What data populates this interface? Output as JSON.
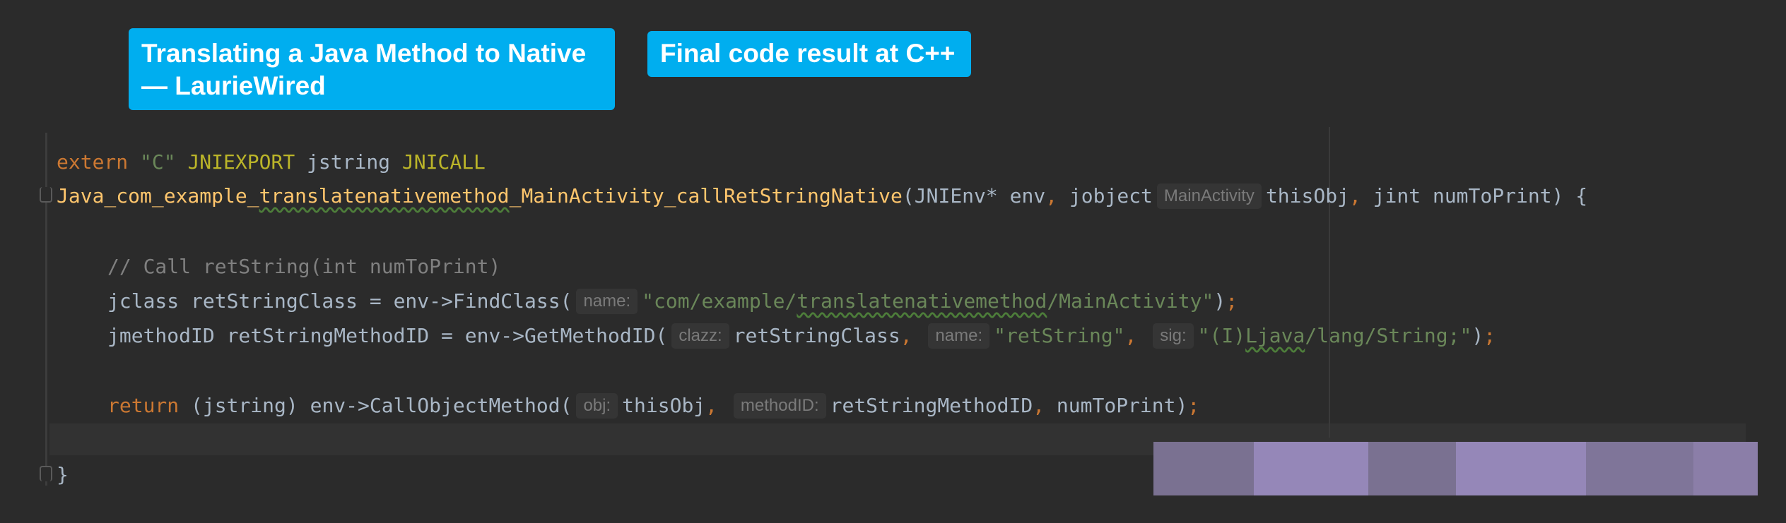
{
  "labels": {
    "title_line1": "Translating a Java Method to Native",
    "title_line2": "— LaurieWired",
    "result": "Final code result at C++"
  },
  "code": {
    "line1": {
      "kw1": "extern",
      "str1": "\"C\"",
      "macro1": "JNIEXPORT",
      "type1": "jstring",
      "macro2": "JNICALL"
    },
    "line2": {
      "fn_part1": "Java_com_example_",
      "fn_part2": "translatenativemethod",
      "fn_part3": "_MainActivity_callRetStringNative",
      "args1": "(JNIEnv* env",
      "comma1": ",",
      "args2": " jobject",
      "hint": "MainActivity",
      "args3": "thisObj",
      "comma2": ",",
      "args4": " jint numToPrint) {"
    },
    "line3": {
      "comment": "// Call retString(int numToPrint)"
    },
    "line4": {
      "pre": "jclass retStringClass = env->FindClass(",
      "hint": "name:",
      "str_part1": "\"com/example/",
      "str_part2": "translatenativemethod",
      "str_part3": "/MainActivity\"",
      "post": ")",
      "semi": ";"
    },
    "line5": {
      "pre": "jmethodID retStringMethodID = env->GetMethodID(",
      "hint1": "clazz:",
      "arg1": "retStringClass",
      "comma1": ",",
      "hint2": "name:",
      "str1": "\"retString\"",
      "comma2": ",",
      "hint3": "sig:",
      "str2_part1": "\"(I)",
      "str2_part2": "Ljava",
      "str2_part3": "/lang/String;\"",
      "post": ")",
      "semi": ";"
    },
    "line6": {
      "kw": "return",
      "pre": " (jstring) env->CallObjectMethod(",
      "hint1": "obj:",
      "arg1": "thisObj",
      "comma1": ",",
      "hint2": "methodID:",
      "arg2": "retStringMethodID",
      "comma2": ",",
      "arg3": " numToPrint)",
      "semi": ";"
    },
    "line7": {
      "brace": "}"
    }
  },
  "overlay_colors": [
    "#7a7191",
    "#9587b8",
    "#7a7191",
    "#9587b8",
    "#7f7599",
    "#8b7ea8"
  ]
}
